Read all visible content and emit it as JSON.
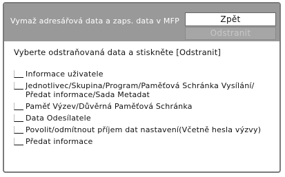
{
  "header": {
    "title": "Vymaž adresářová data a zaps. data v MFP"
  },
  "buttons": {
    "back_label": "Zpět",
    "delete_label": "Odstranit"
  },
  "instruction": "Vyberte odstraňovaná data a stiskněte [Odstranit]",
  "items": [
    {
      "label": "Informace uživatele",
      "checked": false
    },
    {
      "label": "Jednotlivec/Skupina/Program/Paměťová Schránka Vysílání/ Předat informace/Sada Metadat",
      "checked": false
    },
    {
      "label": "Paměť Výzev/Důvěrná Paměťová Schránka",
      "checked": false
    },
    {
      "label": "Data Odesílatele",
      "checked": false
    },
    {
      "label": "Povolit/odmítnout příjem dat nastavení(Včetně hesla výzvy)",
      "checked": false
    },
    {
      "label": "Předat informace",
      "checked": false
    }
  ],
  "colors": {
    "header_bg": "#999999",
    "disabled_button_bg": "#a6a6a6"
  }
}
